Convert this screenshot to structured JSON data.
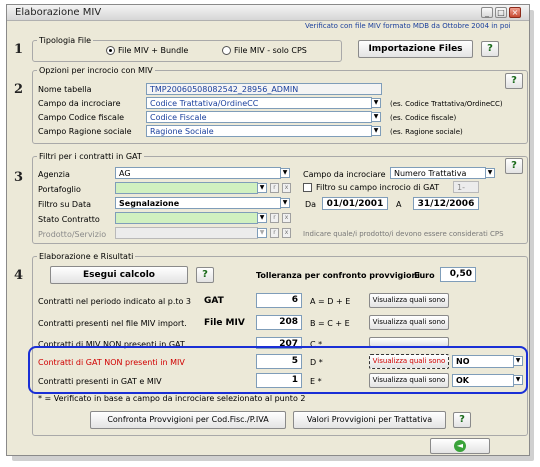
{
  "window": {
    "title": "Elaborazione MIV"
  },
  "verify_text": "Verificato con file MIV formato MDB da Ottobre 2004 in poi",
  "section1": {
    "number": "1",
    "legend": "Tipologia File",
    "radio1": "File MIV + Bundle",
    "radio2": "File MIV - solo CPS",
    "import_button": "Importazione Files",
    "help": "?"
  },
  "section2": {
    "number": "2",
    "legend": "Opzioni per incrocio con MIV",
    "help": "?",
    "rows": [
      {
        "label": "Nome tabella",
        "value": "TMP20060508082542_28956_ADMIN",
        "note": ""
      },
      {
        "label": "Campo da incrociare",
        "value": "Codice Trattativa/OrdineCC",
        "note": "(es. Codice Trattativa/OrdineCC)"
      },
      {
        "label": "Campo Codice fiscale",
        "value": "Codice Fiscale",
        "note": "(es. Codice fiscale)"
      },
      {
        "label": "Campo Ragione sociale",
        "value": "Ragione Sociale",
        "note": "(es. Ragione sociale)"
      }
    ]
  },
  "section3": {
    "number": "3",
    "legend": "Filtri per i contratti in GAT",
    "help": "?",
    "agenzia_label": "Agenzia",
    "agenzia_value": "AG",
    "portafoglio_label": "Portafoglio",
    "filtro_data_label": "Filtro su Data",
    "filtro_data_value": "Segnalazione",
    "stato_label": "Stato Contratto",
    "prodotto_label": "Prodotto/Servizio",
    "campo_label": "Campo da incrociare",
    "campo_value": "Numero Trattativa",
    "filtro_incrocio_label": "Filtro su campo incrocio di GAT",
    "filtro_incrocio_value": "1-",
    "da_label": "Da",
    "da_value": "01/01/2001",
    "a_label": "A",
    "a_value": "31/12/2006",
    "hint": "Indicare quale/i prodotto/i devono essere considerati CPS",
    "mini_r": "r",
    "mini_x": "x"
  },
  "section4": {
    "number": "4",
    "legend": "Elaborazione e Risultati",
    "esegui": "Esegui calcolo",
    "help": "?",
    "tolleranza_label": "Tolleranza per confronto provvigioni",
    "euro_label": "Euro",
    "tolleranza_value": "0,50",
    "rows": [
      {
        "label": "Contratti nel periodo indicato al p.to 3",
        "tag": "GAT",
        "value": "6",
        "formula": "A = D + E",
        "button": "Visualizza quali sono",
        "select": ""
      },
      {
        "label": "Contratti presenti nel file MIV import.",
        "tag": "File MIV",
        "value": "208",
        "formula": "B = C + E",
        "button": "Visualizza quali sono",
        "select": ""
      },
      {
        "label": "Contratti di MIV NON presenti in GAT",
        "tag": "",
        "value": "207",
        "formula": "C  *",
        "button": "",
        "select": ""
      },
      {
        "label": "Contratti di GAT NON presenti in MIV",
        "tag": "",
        "value": "5",
        "formula": "D  *",
        "button": "Visualizza quali sono",
        "select": "NO"
      },
      {
        "label": "Contratti presenti in GAT e MIV",
        "tag": "",
        "value": "1",
        "formula": "E  *",
        "button": "Visualizza quali sono",
        "select": "OK"
      }
    ],
    "footnote": "* = Verificato in base a campo da incrociare selezionato al punto 2",
    "btn_confronta": "Confronta Provvigioni per Cod.Fisc./P.IVA",
    "btn_valori": "Valori Provvigioni per Trattativa",
    "help2": "?"
  },
  "colors": {
    "highlight": "#1a2fd6",
    "red_label": "#d00000",
    "green_field": "#d0f0c0"
  }
}
